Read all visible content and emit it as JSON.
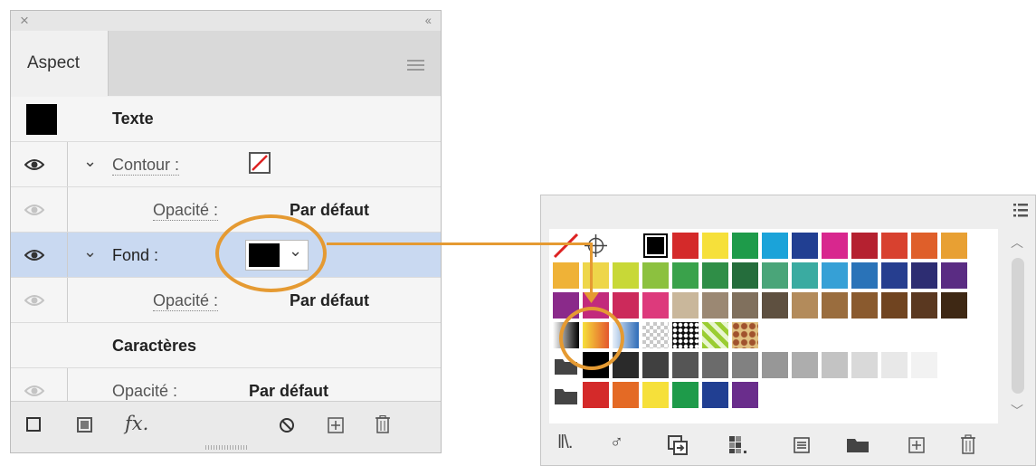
{
  "aspect_panel": {
    "close_glyph": "×",
    "collapse_glyph": "‹‹",
    "tab_label": "Aspect",
    "rows": {
      "texte": "Texte",
      "contour_label": "Contour :",
      "contour_opacity_label": "Opacité :",
      "contour_opacity_value": "Par défaut",
      "fond_label": "Fond :",
      "fond_opacity_label": "Opacité :",
      "fond_opacity_value": "Par défaut",
      "caracteres": "Caractères",
      "char_opacity_label": "Opacité :",
      "char_opacity_value": "Par défaut"
    },
    "chevron_glyph": "⌄",
    "fx_label": "fx.",
    "colors": {
      "selected_row": "#c9d9f1",
      "accent": "#e59a32"
    }
  },
  "swatches_panel": {
    "row1": [
      "none",
      "registration",
      "white",
      "black-selected",
      "#d42a2a",
      "#f6e03a",
      "#1e9b4a",
      "#1ba3d9",
      "#213f92",
      "#d8278e",
      "#b52130",
      "#d8412f",
      "#df5f2a",
      "#e8a033"
    ],
    "row2": [
      "#efb237",
      "#eed64a",
      "#c8d837",
      "#8cc13f",
      "#3aa24b",
      "#2f8e47",
      "#256d3c",
      "#4aa579",
      "#3aaba1",
      "#36a0d6",
      "#2a73b8",
      "#263e8f",
      "#2d2d72",
      "#5a2c83"
    ],
    "row3": [
      "#8a2a8a",
      "#c22a7c",
      "#cc2a5b",
      "#dd3a7c",
      "#c9b79b",
      "#9b8873",
      "#80705d",
      "#5e5040",
      "#b38b5b",
      "#9a6d3e",
      "#8a5a2e",
      "#704420",
      "#5a3820",
      "#3e2814"
    ],
    "row4": [
      "gradient-bw",
      "gradient-yellow",
      "gradient-blue",
      "pattern-check",
      "pattern-dots",
      "pattern-leaves",
      "pattern-floral"
    ],
    "row5": [
      "folder",
      "#000000",
      "#2a2a2a",
      "#404040",
      "#555555",
      "#6b6b6b",
      "#818181",
      "#979797",
      "#adadad",
      "#c3c3c3",
      "#d9d9d9",
      "#e8e8e8",
      "#f2f2f2"
    ],
    "row6": [
      "folder",
      "#d42a2a",
      "#e46a25",
      "#f6e03a",
      "#1e9b4a",
      "#213f92",
      "#6a2d8c"
    ],
    "bottom_icons": [
      "library-icon",
      "find-icon",
      "place-icon",
      "color-group-icon",
      "options-icon",
      "new-group-icon",
      "new-swatch-icon",
      "trash-icon"
    ]
  }
}
